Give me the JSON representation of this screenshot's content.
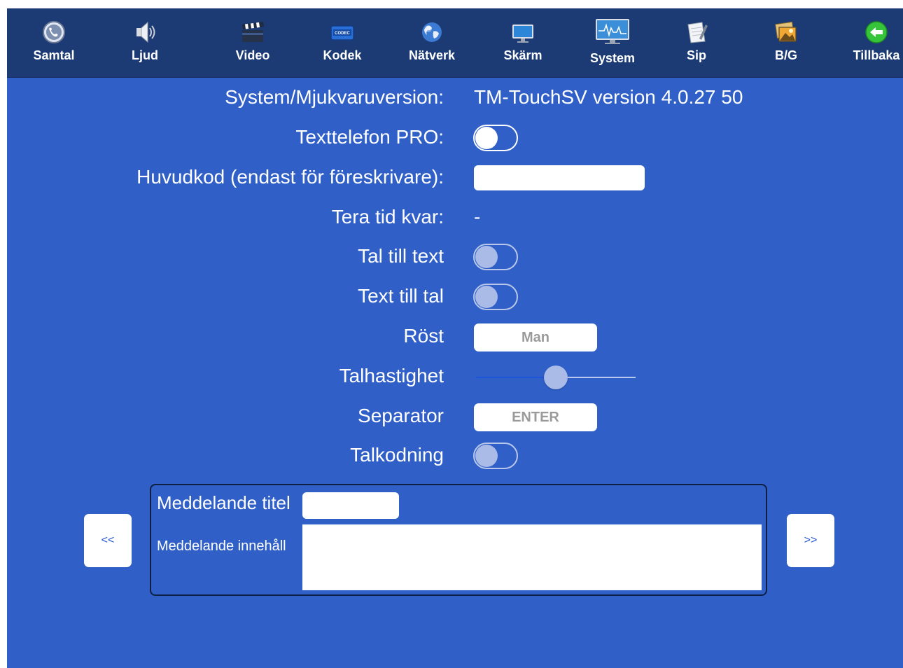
{
  "toolbar": {
    "tabs": [
      {
        "label": "Samtal",
        "icon": "phone-gear-icon"
      },
      {
        "label": "Ljud",
        "icon": "speaker-icon"
      },
      {
        "label": "Video",
        "icon": "clapperboard-icon"
      },
      {
        "label": "Kodek",
        "icon": "codec-icon"
      },
      {
        "label": "Nätverk",
        "icon": "globe-icon"
      },
      {
        "label": "Skärm",
        "icon": "monitor-icon"
      },
      {
        "label": "System",
        "icon": "system-monitor-icon",
        "active": true
      },
      {
        "label": "Sip",
        "icon": "notepad-icon"
      },
      {
        "label": "B/G",
        "icon": "picture-icon"
      },
      {
        "label": "Tillbaka",
        "icon": "back-arrow-icon"
      }
    ]
  },
  "settings": {
    "version_label": "System/Mjukvaruversion:",
    "version_value": "TM-TouchSV version 4.0.27 50",
    "texttelefon_label": "Texttelefon PRO:",
    "texttelefon_on": false,
    "master_code_label": "Huvudkod (endast för föreskrivare):",
    "master_code_value": "",
    "tera_label": "Tera tid kvar:",
    "tera_value": "-",
    "speech_to_text_label": "Tal till text",
    "speech_to_text_on": false,
    "text_to_speech_label": "Text till tal",
    "text_to_speech_on": false,
    "voice_label": "Röst",
    "voice_value": "Man",
    "speech_rate_label": "Talhastighet",
    "speech_rate_fraction": 0.5,
    "separator_label": "Separator",
    "separator_value": "ENTER",
    "speech_coding_label": "Talkodning",
    "speech_coding_on": false
  },
  "message": {
    "title_label": "Meddelande titel",
    "title_value": "",
    "body_label": "Meddelande innehåll",
    "body_value": "",
    "prev_label": "<<",
    "next_label": ">>"
  },
  "colors": {
    "background": "#2f5fc7",
    "toolbar": "#1c3a73",
    "slider_fill": "#1f56d9"
  }
}
